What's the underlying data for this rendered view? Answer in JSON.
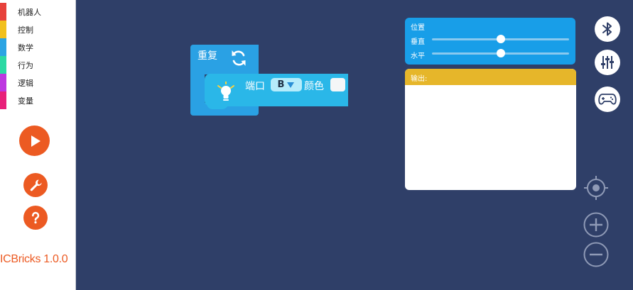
{
  "sidebar": {
    "categories": [
      {
        "label": "机器人",
        "color": "#e7413b"
      },
      {
        "label": "控制",
        "color": "#f2c01d"
      },
      {
        "label": "数学",
        "color": "#2ba4e3"
      },
      {
        "label": "行为",
        "color": "#2bd9a3"
      },
      {
        "label": "逻辑",
        "color": "#bd37e0"
      },
      {
        "label": "变量",
        "color": "#e8207a"
      }
    ],
    "run_icon": "play-icon",
    "settings_icon": "wrench-icon",
    "help_icon": "question-icon",
    "version": "ICBricks 1.0.0",
    "accent_color": "#ec5a22"
  },
  "workspace": {
    "repeat_block": {
      "label": "重复",
      "icon": "loop-refresh-icon"
    },
    "led_block": {
      "icon": "light-bulb-icon",
      "port_label": "端口",
      "port_value": "B",
      "color_label": "颜色"
    }
  },
  "position_panel": {
    "title": "位置",
    "vertical_label": "垂直",
    "horizontal_label": "水平",
    "vertical_value": 0.5,
    "horizontal_value": 0.5
  },
  "output_panel": {
    "title": "输出:",
    "content": ""
  },
  "toolbar": {
    "bluetooth_icon": "bluetooth-icon",
    "mixer_icon": "sliders-icon",
    "gamepad_icon": "gamepad-icon"
  },
  "workspace_controls": {
    "center_icon": "recenter-target-icon",
    "zoom_in_icon": "zoom-in-icon",
    "zoom_out_icon": "zoom-out-icon"
  }
}
